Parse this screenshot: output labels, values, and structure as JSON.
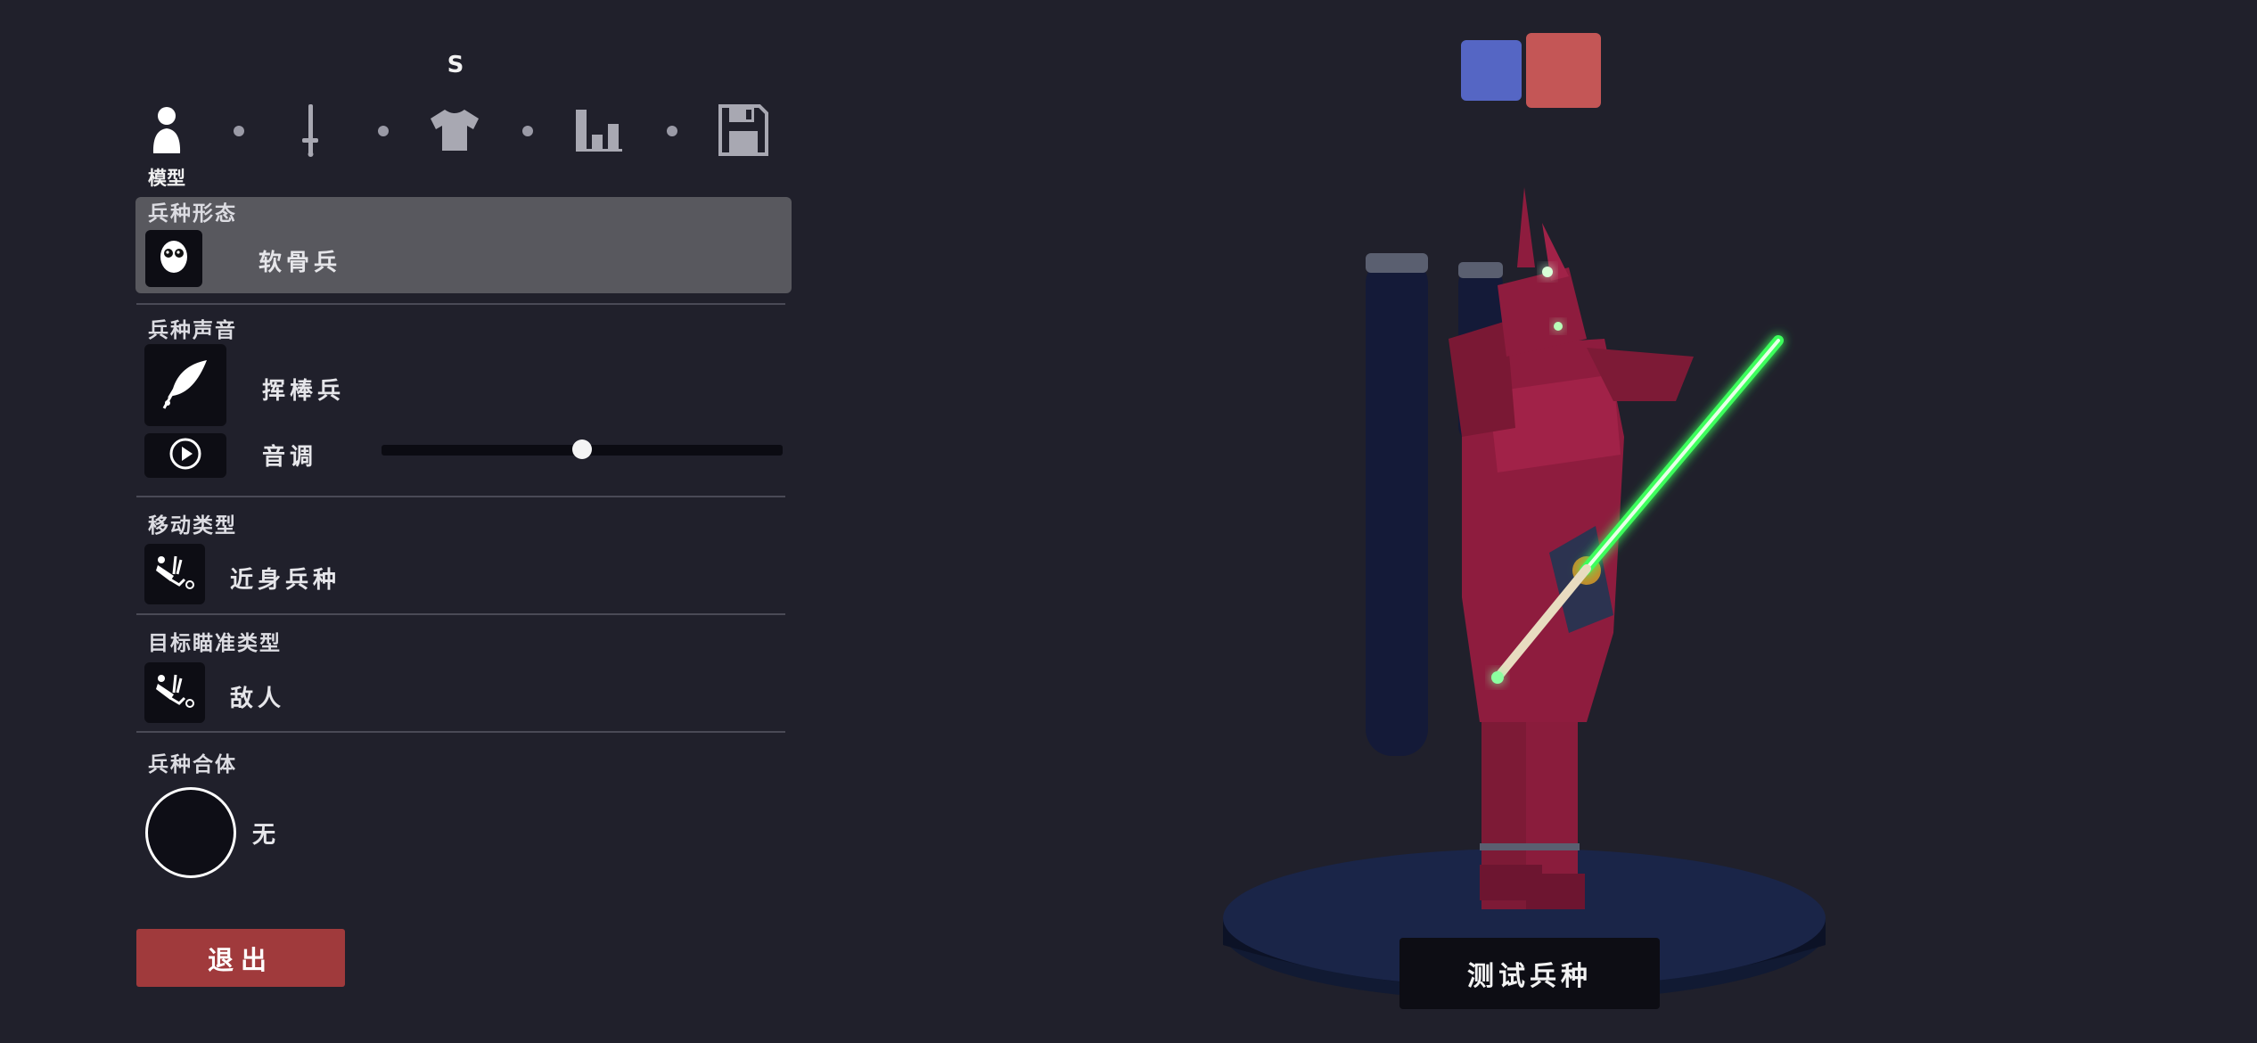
{
  "nav": {
    "top_label": "S",
    "tabs": [
      {
        "icon": "person-icon"
      },
      {
        "icon": "sword-icon"
      },
      {
        "icon": "shirt-icon"
      },
      {
        "icon": "stats-icon"
      },
      {
        "icon": "save-icon"
      }
    ],
    "active_caption": "模型"
  },
  "sections": {
    "unit_form": {
      "title": "兵种形态",
      "icon": "skull-face-icon",
      "value": "软骨兵"
    },
    "unit_voice": {
      "title": "兵种声音",
      "icon": "feather-icon",
      "value": "挥棒兵",
      "pitch_label": "音调",
      "pitch_value": 0.5
    },
    "movement": {
      "title": "移动类型",
      "icon": "melee-unit-icon",
      "value": "近身兵种"
    },
    "targeting": {
      "title": "目标瞄准类型",
      "icon": "melee-unit-icon",
      "value": "敌人"
    },
    "merge": {
      "title": "兵种合体",
      "value": "无"
    }
  },
  "exit_label": "退出",
  "test_label": "测试兵种",
  "colors": {
    "team_blue": "#5566c4",
    "team_red": "#c45656",
    "accent_exit": "#a03a3c"
  }
}
